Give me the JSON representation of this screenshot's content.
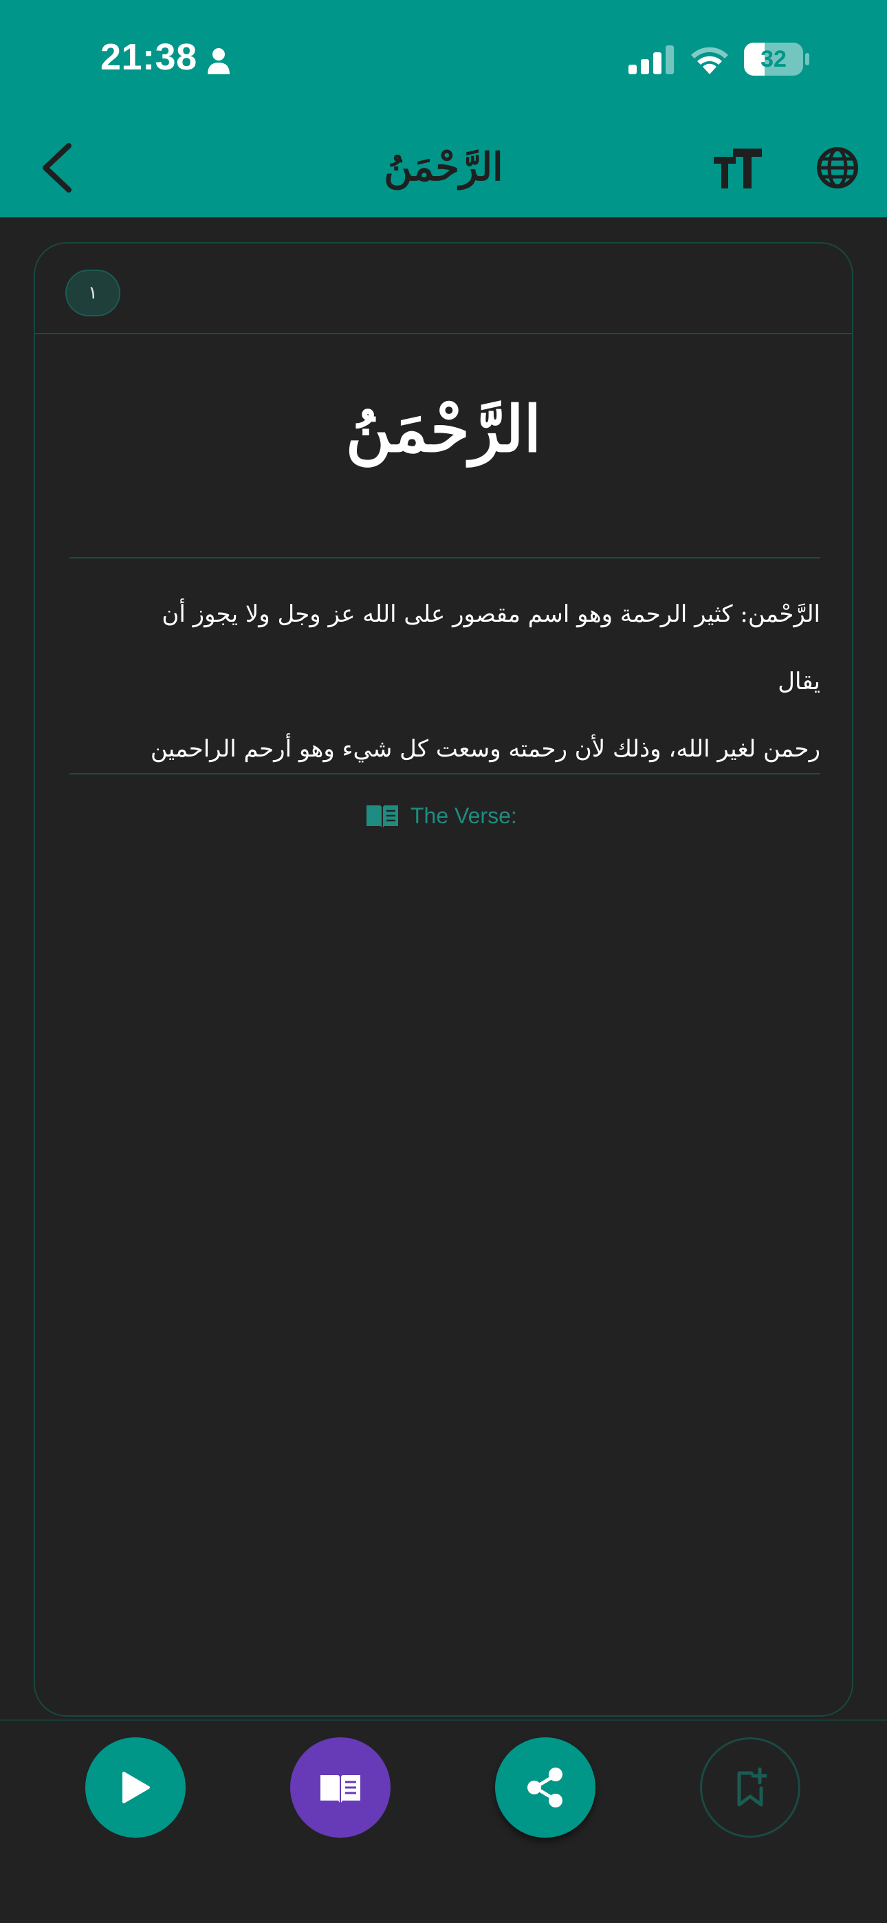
{
  "status_bar": {
    "time": "21:38",
    "battery": "32"
  },
  "nav": {
    "title": "الرَّحْمَنُ",
    "back_icon": "chevron-left-icon",
    "font_size_icon": "text-size-icon",
    "language_icon": "globe-icon"
  },
  "card": {
    "number": "١",
    "name": "الرَّحْمَنُ",
    "description_lines": [
      "الرَّحْمن: كثير الرحمة وهو اسم مقصور على الله عز وجل ولا يجوز أن يقال",
      "رحمن لغير الله، وذلك لأن رحمته وسعت كل شيء وهو أرحم الراحمين"
    ],
    "verse_label": "The Verse:",
    "verse_icon": "open-book-icon"
  },
  "actions": {
    "play_icon": "play-icon",
    "read_icon": "book-icon",
    "share_icon": "share-icon",
    "bookmark_icon": "bookmark-add-icon"
  },
  "colors": {
    "accent": "#009688",
    "purple": "#673AB7",
    "background": "#222222",
    "card_border": "#18483F"
  }
}
